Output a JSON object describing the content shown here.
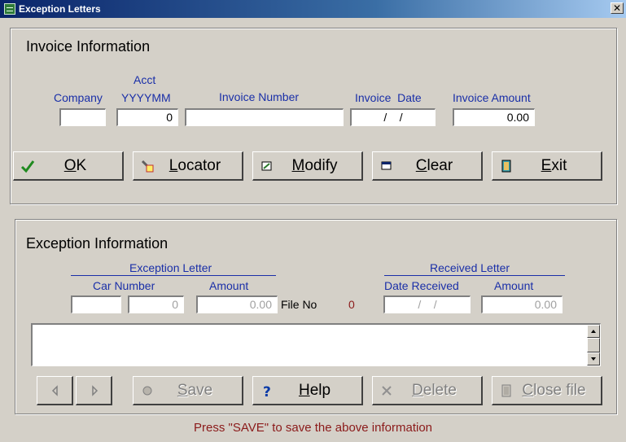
{
  "window": {
    "title": "Exception Letters",
    "close_glyph": "✕"
  },
  "invoice": {
    "title": "Invoice Information",
    "labels": {
      "company": "Company",
      "acct_line1": "Acct",
      "acct_line2": "YYYYMM",
      "invoice_number": "Invoice Number",
      "invoice_date": "Invoice  Date",
      "invoice_amount": "Invoice Amount"
    },
    "fields": {
      "company": "",
      "acct": "0",
      "invoice_number": "",
      "invoice_date": "/    /",
      "invoice_amount": "0.00"
    },
    "buttons": {
      "ok": {
        "hot": "O",
        "rest": "K",
        "icon": "check-icon"
      },
      "locator": {
        "hot": "L",
        "rest": "ocator",
        "icon": "flashlight-icon"
      },
      "modify": {
        "hot": "M",
        "rest": "odify",
        "icon": "edit-icon"
      },
      "clear": {
        "hot": "C",
        "rest": "lear",
        "icon": "window-icon"
      },
      "exit": {
        "hot": "E",
        "rest": "xit",
        "icon": "door-icon"
      }
    }
  },
  "exception": {
    "title": "Exception Information",
    "exception_letter": "Exception Letter",
    "received_letter": "Received Letter",
    "labels": {
      "car_number": "Car Number",
      "amount": "Amount",
      "file_no": "File No",
      "date_received": "Date Received",
      "received_amount": "Amount"
    },
    "fields": {
      "car_prefix": "",
      "car_number": "0",
      "amount": "0.00",
      "file_no": "0",
      "date_received": "/    /",
      "received_amount": "0.00"
    },
    "buttons": {
      "prev": {
        "icon": "arrow-left-icon"
      },
      "next": {
        "icon": "arrow-right-icon"
      },
      "save": {
        "hot": "S",
        "rest": "ave",
        "icon": "circle-icon"
      },
      "help": {
        "hot": "H",
        "rest": "elp",
        "icon": "question-icon"
      },
      "delete": {
        "hot": "D",
        "rest": "elete",
        "icon": "x-icon"
      },
      "close_file": {
        "hot": "C",
        "rest": "lose file",
        "icon": "door-icon"
      }
    }
  },
  "status_text": "Press \"SAVE\" to save the above information",
  "colors": {
    "label_blue": "#1a2fa8",
    "status_red": "#8b1a1a",
    "face": "#d4d0c8"
  }
}
